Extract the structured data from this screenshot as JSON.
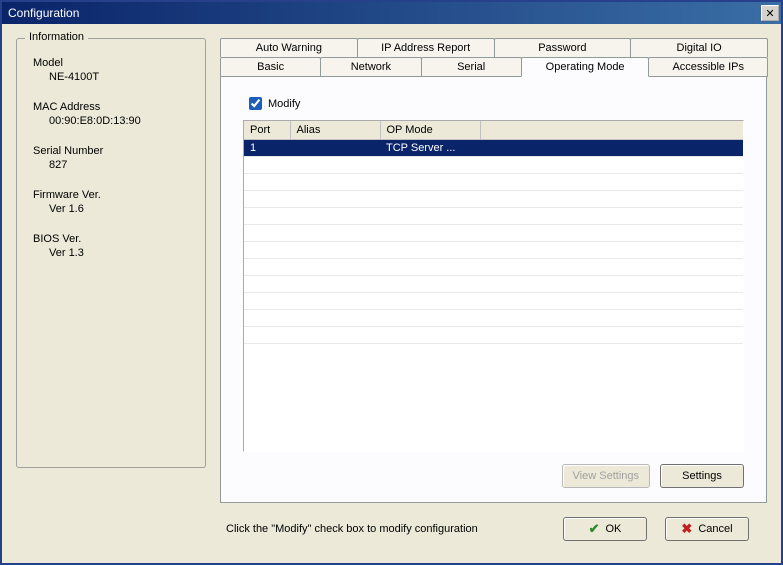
{
  "window": {
    "title": "Configuration"
  },
  "info": {
    "legend": "Information",
    "model_label": "Model",
    "model_value": "NE-4100T",
    "mac_label": "MAC Address",
    "mac_value": "00:90:E8:0D:13:90",
    "serial_label": "Serial Number",
    "serial_value": "827",
    "fw_label": "Firmware Ver.",
    "fw_value": "Ver 1.6",
    "bios_label": "BIOS Ver.",
    "bios_value": "Ver 1.3"
  },
  "tabs_top": {
    "auto_warning": "Auto Warning",
    "ip_report": "IP Address Report",
    "password": "Password",
    "digital_io": "Digital IO"
  },
  "tabs_bottom": {
    "basic": "Basic",
    "network": "Network",
    "serial": "Serial",
    "operating_mode": "Operating Mode",
    "accessible_ips": "Accessible IPs"
  },
  "modify": {
    "label": "Modify",
    "checked": true
  },
  "table": {
    "headers": {
      "port": "Port",
      "alias": "Alias",
      "op_mode": "OP Mode"
    },
    "rows": [
      {
        "port": "1",
        "alias": "",
        "op_mode": "TCP Server ..."
      }
    ]
  },
  "buttons": {
    "view_settings": "View Settings",
    "settings": "Settings",
    "ok": "OK",
    "cancel": "Cancel"
  },
  "footer_hint": "Click the \"Modify\" check box to modify configuration"
}
